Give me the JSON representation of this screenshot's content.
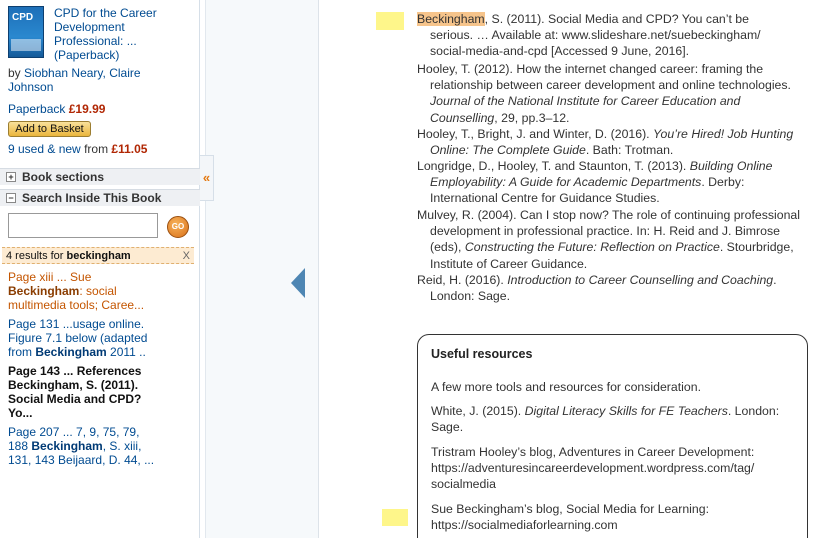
{
  "sidebar": {
    "book": {
      "cover_text": "CPD",
      "title_line1": "CPD for the Career",
      "title_line2": "Development",
      "title_line3": "Professional: ...",
      "title_line4": "(Paperback)",
      "by_label": "by",
      "authors_line1": "Siobhan Neary, Claire",
      "authors_line2": "Johnson",
      "format_label": "Paperback",
      "price": "£19.99",
      "basket_label": "Add to Basket",
      "used_link": "9 used & new",
      "used_from": "from",
      "used_price": "£11.05"
    },
    "sections": {
      "book_sections_label": "Book sections",
      "book_sections_toggle": "+",
      "search_inside_label": "Search Inside This Book",
      "search_inside_toggle": "−"
    },
    "search": {
      "value": "",
      "go_label": "GO"
    },
    "results_header": {
      "count_text": "4 results for",
      "query": "beckingham",
      "close": "X"
    },
    "results": [
      {
        "l1": "Page xiii ... Sue",
        "l2_hl": "Beckingham",
        "l2": ": social",
        "l3": "multimedia tools; Caree..."
      },
      {
        "l1": "Page 131 ...usage online.",
        "l2": "Figure 7.1 below (adapted",
        "l3a": "from",
        "l3_hl": "Beckingham",
        "l3b": "2011 .."
      },
      {
        "l1": "Page 143 ... References",
        "l2": "Beckingham, S. (2011).",
        "l3": "Social Media and CPD?",
        "l4": "Yo..."
      },
      {
        "l1": "Page 207 ... 7, 9, 75, 79,",
        "l2a": "188",
        "l2_hl": "Beckingham",
        "l2b": ", S. xiii,",
        "l3": "131, 143 Beijaard, D. 44, ..."
      }
    ]
  },
  "viewer": {
    "collapse_icon": "«",
    "prev_icon": "prev-arrow-icon"
  },
  "page": {
    "refs": [
      {
        "hl": "Beckingham",
        "a": ", S. (2011). Social Media and CPD? You can’t be",
        "b": "serious. … Available at: www.slideshare.net/suebeckingham/",
        "c": "social-media-and-cpd [Accessed 9 June, 2016]."
      },
      {
        "a": "Hooley, T. (2012). How the internet changed career: framing the",
        "b": "relationship between career development and online technologies.",
        "c_i": "Journal of the National Institute for Career Education and",
        "d_i": "Counselling",
        "d": ", 29, pp.3–12."
      },
      {
        "a": "Hooley, T., Bright, J. and Winter, D. (2016). ",
        "a_i": "You’re Hired! Job Hunting",
        "b_i": "Online: The Complete Guide",
        "b": ". Bath: Trotman."
      },
      {
        "a": "Longridge, D., Hooley, T. and Staunton, T. (2013). ",
        "a_i": "Building Online",
        "b_i": "Employability: A Guide for Academic Departments",
        "b": ". Derby:",
        "c": "International Centre for Guidance Studies."
      },
      {
        "a": "Mulvey, R. (2004). Can I stop now? The role of continuing professional",
        "b": "development in professional practice. In: H. Reid and J. Bimrose",
        "c": "(eds), ",
        "c_i": "Constructing the Future: Reflection on Practice",
        "c2": ". Stourbridge,",
        "d": "Institute of Career Guidance."
      },
      {
        "a": "Reid, H. (2016). ",
        "a_i": "Introduction to Career Counselling and Coaching",
        "a2": ".",
        "b": "London: Sage."
      }
    ],
    "box": {
      "title": "Useful resources",
      "intro": "A few more tools and resources for consideration.",
      "white_a": "White, J. (2015). ",
      "white_i": "Digital Literacy Skills for FE Teachers",
      "white_b": ". London:",
      "white_c": "Sage.",
      "hooley_a": "Tristram Hooley’s blog, Adventures in Career Development:",
      "hooley_b": "https://adventuresincareerdevelopment.wordpress.com/tag/",
      "hooley_c": "socialmedia",
      "sue_a": "Sue Beckingham’s blog, Social Media for Learning:",
      "sue_b": "https://socialmediaforlearning.com"
    }
  },
  "colors": {
    "link": "#004b91",
    "price": "#b12704",
    "highlight": "#f6c48b",
    "marker": "#fef68a",
    "arrow": "#4e86b3"
  }
}
